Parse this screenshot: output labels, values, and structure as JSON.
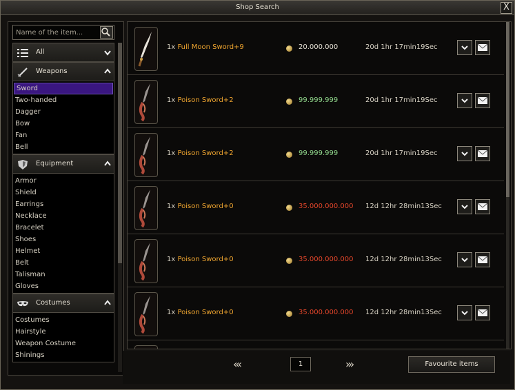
{
  "window": {
    "title": "Shop Search",
    "close_glyph": "X"
  },
  "search": {
    "placeholder": "Name of the item..."
  },
  "categories": [
    {
      "label": "All",
      "icon": "list-icon",
      "expanded": false,
      "items": []
    },
    {
      "label": "Weapons",
      "icon": "sword-icon",
      "expanded": true,
      "items": [
        "Sword",
        "Two-handed",
        "Dagger",
        "Bow",
        "Fan",
        "Bell"
      ],
      "selected": "Sword"
    },
    {
      "label": "Equipment",
      "icon": "shield-icon",
      "expanded": true,
      "items": [
        "Armor",
        "Shield",
        "Earrings",
        "Necklace",
        "Bracelet",
        "Shoes",
        "Helmet",
        "Belt",
        "Talisman",
        "Gloves"
      ]
    },
    {
      "label": "Costumes",
      "icon": "mask-icon",
      "expanded": true,
      "items": [
        "Costumes",
        "Hairstyle",
        "Weapon Costume",
        "Shinings"
      ]
    }
  ],
  "listings": [
    {
      "qty": "1x",
      "name": "Full Moon Sword+9",
      "price": "20.000.000",
      "price_color": "white",
      "time": "20d 1hr 17min19Sec",
      "icon": "full-moon-sword-icon"
    },
    {
      "qty": "1x",
      "name": "Poison Sword+2",
      "price": "99.999.999",
      "price_color": "green",
      "time": "20d 1hr 17min19Sec",
      "icon": "poison-sword-icon"
    },
    {
      "qty": "1x",
      "name": "Poison Sword+2",
      "price": "99.999.999",
      "price_color": "green",
      "time": "20d 1hr 17min19Sec",
      "icon": "poison-sword-icon"
    },
    {
      "qty": "1x",
      "name": "Poison Sword+0",
      "price": "35.000.000.000",
      "price_color": "red",
      "time": "12d 12hr 28min13Sec",
      "icon": "poison-sword-icon"
    },
    {
      "qty": "1x",
      "name": "Poison Sword+0",
      "price": "35.000.000.000",
      "price_color": "red",
      "time": "12d 12hr 28min13Sec",
      "icon": "poison-sword-icon"
    },
    {
      "qty": "1x",
      "name": "Poison Sword+0",
      "price": "35.000.000.000",
      "price_color": "red",
      "time": "12d 12hr 28min13Sec",
      "icon": "poison-sword-icon"
    }
  ],
  "pager": {
    "first_glyph": "«‹",
    "current_page": "1",
    "next_glyph": "›»"
  },
  "favourite_button": "Favourite items",
  "colors": {
    "selected_bg": "#3a1680",
    "item_name": "#f0a630",
    "price_green": "#8fd48a",
    "price_red": "#e0452a"
  }
}
